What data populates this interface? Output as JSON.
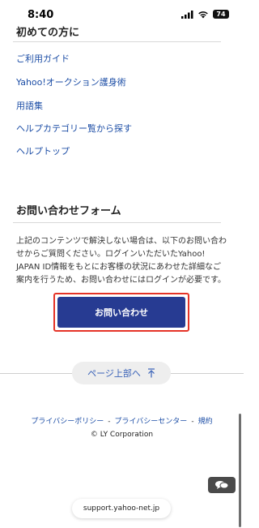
{
  "status_bar": {
    "time": "8:40",
    "battery": "74"
  },
  "help": {
    "heading": "初めての方に",
    "links": [
      "ご利用ガイド",
      "Yahoo!オークション護身術",
      "用語集",
      "ヘルプカテゴリー覧から探す",
      "ヘルプトップ"
    ]
  },
  "contact": {
    "title": "お問い合わせフォーム",
    "text": "上記のコンテンツで解決しない場合は、以下のお問い合わせからご質問ください。ログインいただいたYahoo! JAPAN ID情報をもとにお客様の状況にあわせた詳細なご案内を行うため、お問い合わせにはログインが必要です。",
    "button_label": "お問い合わせ"
  },
  "page_top": {
    "label": "ページ上部へ"
  },
  "footer": {
    "links": [
      "プライバシーポリシー",
      "プライバシーセンター",
      "規約"
    ],
    "separator": "-",
    "copyright": "© LY Corporation"
  },
  "browser": {
    "url": "support.yahoo-net.jp"
  },
  "icons": {
    "signal": "signal-icon",
    "wifi": "wifi-icon",
    "battery": "battery-icon",
    "arrow_up": "arrow-up-icon",
    "chat": "chat-icon"
  },
  "colors": {
    "link": "#1d4ea6",
    "cta": "#273b92",
    "highlight": "#e53327"
  }
}
